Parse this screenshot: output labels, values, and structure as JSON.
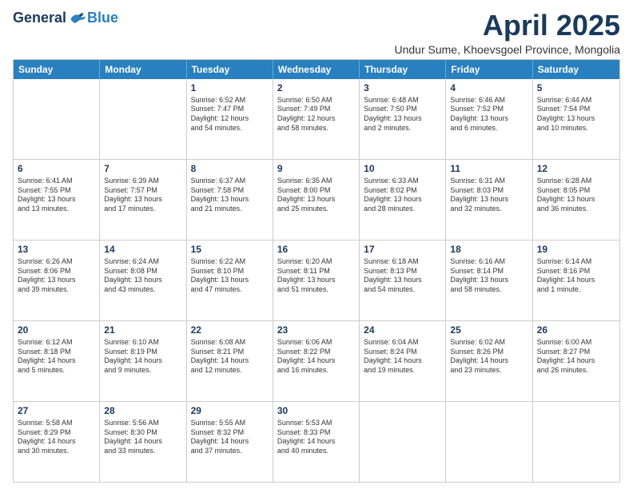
{
  "logo": {
    "general": "General",
    "blue": "Blue"
  },
  "title": "April 2025",
  "subtitle": "Undur Sume, Khoevsgoel Province, Mongolia",
  "weekdays": [
    "Sunday",
    "Monday",
    "Tuesday",
    "Wednesday",
    "Thursday",
    "Friday",
    "Saturday"
  ],
  "weeks": [
    [
      {
        "day": "",
        "lines": []
      },
      {
        "day": "",
        "lines": []
      },
      {
        "day": "1",
        "lines": [
          "Sunrise: 6:52 AM",
          "Sunset: 7:47 PM",
          "Daylight: 12 hours",
          "and 54 minutes."
        ]
      },
      {
        "day": "2",
        "lines": [
          "Sunrise: 6:50 AM",
          "Sunset: 7:49 PM",
          "Daylight: 12 hours",
          "and 58 minutes."
        ]
      },
      {
        "day": "3",
        "lines": [
          "Sunrise: 6:48 AM",
          "Sunset: 7:50 PM",
          "Daylight: 13 hours",
          "and 2 minutes."
        ]
      },
      {
        "day": "4",
        "lines": [
          "Sunrise: 6:46 AM",
          "Sunset: 7:52 PM",
          "Daylight: 13 hours",
          "and 6 minutes."
        ]
      },
      {
        "day": "5",
        "lines": [
          "Sunrise: 6:44 AM",
          "Sunset: 7:54 PM",
          "Daylight: 13 hours",
          "and 10 minutes."
        ]
      }
    ],
    [
      {
        "day": "6",
        "lines": [
          "Sunrise: 6:41 AM",
          "Sunset: 7:55 PM",
          "Daylight: 13 hours",
          "and 13 minutes."
        ]
      },
      {
        "day": "7",
        "lines": [
          "Sunrise: 6:39 AM",
          "Sunset: 7:57 PM",
          "Daylight: 13 hours",
          "and 17 minutes."
        ]
      },
      {
        "day": "8",
        "lines": [
          "Sunrise: 6:37 AM",
          "Sunset: 7:58 PM",
          "Daylight: 13 hours",
          "and 21 minutes."
        ]
      },
      {
        "day": "9",
        "lines": [
          "Sunrise: 6:35 AM",
          "Sunset: 8:00 PM",
          "Daylight: 13 hours",
          "and 25 minutes."
        ]
      },
      {
        "day": "10",
        "lines": [
          "Sunrise: 6:33 AM",
          "Sunset: 8:02 PM",
          "Daylight: 13 hours",
          "and 28 minutes."
        ]
      },
      {
        "day": "11",
        "lines": [
          "Sunrise: 6:31 AM",
          "Sunset: 8:03 PM",
          "Daylight: 13 hours",
          "and 32 minutes."
        ]
      },
      {
        "day": "12",
        "lines": [
          "Sunrise: 6:28 AM",
          "Sunset: 8:05 PM",
          "Daylight: 13 hours",
          "and 36 minutes."
        ]
      }
    ],
    [
      {
        "day": "13",
        "lines": [
          "Sunrise: 6:26 AM",
          "Sunset: 8:06 PM",
          "Daylight: 13 hours",
          "and 39 minutes."
        ]
      },
      {
        "day": "14",
        "lines": [
          "Sunrise: 6:24 AM",
          "Sunset: 8:08 PM",
          "Daylight: 13 hours",
          "and 43 minutes."
        ]
      },
      {
        "day": "15",
        "lines": [
          "Sunrise: 6:22 AM",
          "Sunset: 8:10 PM",
          "Daylight: 13 hours",
          "and 47 minutes."
        ]
      },
      {
        "day": "16",
        "lines": [
          "Sunrise: 6:20 AM",
          "Sunset: 8:11 PM",
          "Daylight: 13 hours",
          "and 51 minutes."
        ]
      },
      {
        "day": "17",
        "lines": [
          "Sunrise: 6:18 AM",
          "Sunset: 8:13 PM",
          "Daylight: 13 hours",
          "and 54 minutes."
        ]
      },
      {
        "day": "18",
        "lines": [
          "Sunrise: 6:16 AM",
          "Sunset: 8:14 PM",
          "Daylight: 13 hours",
          "and 58 minutes."
        ]
      },
      {
        "day": "19",
        "lines": [
          "Sunrise: 6:14 AM",
          "Sunset: 8:16 PM",
          "Daylight: 14 hours",
          "and 1 minute."
        ]
      }
    ],
    [
      {
        "day": "20",
        "lines": [
          "Sunrise: 6:12 AM",
          "Sunset: 8:18 PM",
          "Daylight: 14 hours",
          "and 5 minutes."
        ]
      },
      {
        "day": "21",
        "lines": [
          "Sunrise: 6:10 AM",
          "Sunset: 8:19 PM",
          "Daylight: 14 hours",
          "and 9 minutes."
        ]
      },
      {
        "day": "22",
        "lines": [
          "Sunrise: 6:08 AM",
          "Sunset: 8:21 PM",
          "Daylight: 14 hours",
          "and 12 minutes."
        ]
      },
      {
        "day": "23",
        "lines": [
          "Sunrise: 6:06 AM",
          "Sunset: 8:22 PM",
          "Daylight: 14 hours",
          "and 16 minutes."
        ]
      },
      {
        "day": "24",
        "lines": [
          "Sunrise: 6:04 AM",
          "Sunset: 8:24 PM",
          "Daylight: 14 hours",
          "and 19 minutes."
        ]
      },
      {
        "day": "25",
        "lines": [
          "Sunrise: 6:02 AM",
          "Sunset: 8:26 PM",
          "Daylight: 14 hours",
          "and 23 minutes."
        ]
      },
      {
        "day": "26",
        "lines": [
          "Sunrise: 6:00 AM",
          "Sunset: 8:27 PM",
          "Daylight: 14 hours",
          "and 26 minutes."
        ]
      }
    ],
    [
      {
        "day": "27",
        "lines": [
          "Sunrise: 5:58 AM",
          "Sunset: 8:29 PM",
          "Daylight: 14 hours",
          "and 30 minutes."
        ]
      },
      {
        "day": "28",
        "lines": [
          "Sunrise: 5:56 AM",
          "Sunset: 8:30 PM",
          "Daylight: 14 hours",
          "and 33 minutes."
        ]
      },
      {
        "day": "29",
        "lines": [
          "Sunrise: 5:55 AM",
          "Sunset: 8:32 PM",
          "Daylight: 14 hours",
          "and 37 minutes."
        ]
      },
      {
        "day": "30",
        "lines": [
          "Sunrise: 5:53 AM",
          "Sunset: 8:33 PM",
          "Daylight: 14 hours",
          "and 40 minutes."
        ]
      },
      {
        "day": "",
        "lines": []
      },
      {
        "day": "",
        "lines": []
      },
      {
        "day": "",
        "lines": []
      }
    ]
  ]
}
